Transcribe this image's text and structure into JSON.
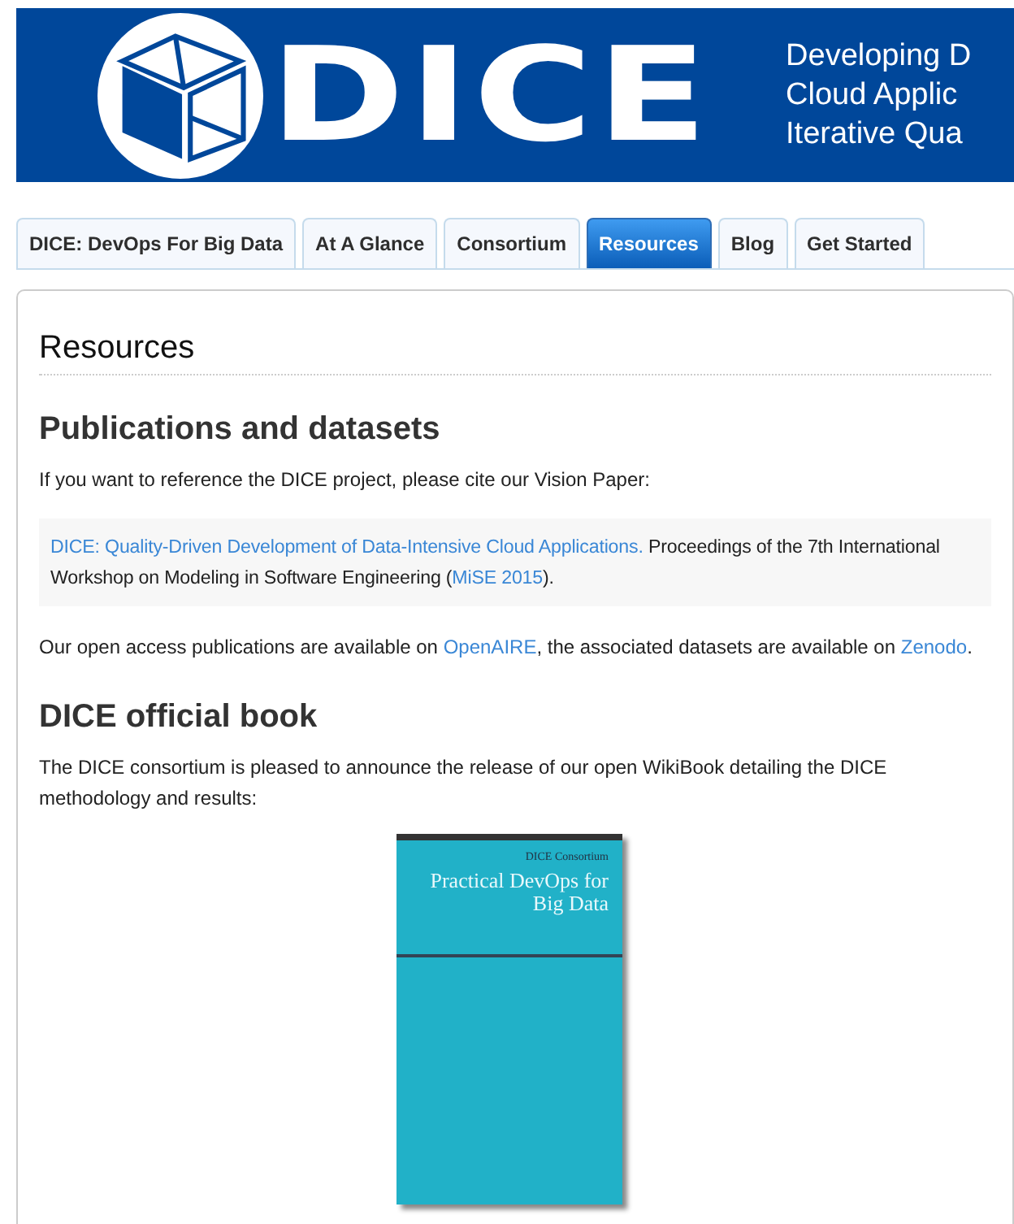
{
  "banner": {
    "logo_text": "DICE",
    "tagline": [
      "Developing D",
      "Cloud Applic",
      "Iterative Qua"
    ]
  },
  "tabs": [
    {
      "label": "DICE: DevOps For Big Data",
      "selected": false
    },
    {
      "label": "At A Glance",
      "selected": false
    },
    {
      "label": "Consortium",
      "selected": false
    },
    {
      "label": "Resources",
      "selected": true
    },
    {
      "label": "Blog",
      "selected": false
    },
    {
      "label": "Get Started",
      "selected": false
    }
  ],
  "page_title": "Resources",
  "sections": [
    {
      "heading": "Publications and datasets",
      "blocks": [
        {
          "kind": "paragraph",
          "segments": [
            {
              "text": "If you want to reference the DICE project, please cite our Vision Paper:",
              "link": false
            }
          ]
        },
        {
          "kind": "citation",
          "segments": [
            {
              "text": "DICE: Quality-Driven Development of Data-Intensive Cloud Applications.",
              "link": true
            },
            {
              "text": " Proceedings of the 7th International Workshop on Modeling in Software Engineering (",
              "link": false
            },
            {
              "text": "MiSE 2015",
              "link": true
            },
            {
              "text": ").",
              "link": false
            }
          ]
        },
        {
          "kind": "paragraph",
          "segments": [
            {
              "text": "Our open access publications are available on ",
              "link": false
            },
            {
              "text": "OpenAIRE",
              "link": true
            },
            {
              "text": ", the associated datasets are available on ",
              "link": false
            },
            {
              "text": "Zenodo",
              "link": true
            },
            {
              "text": ".",
              "link": false
            }
          ]
        }
      ]
    },
    {
      "heading": "DICE official book",
      "blocks": [
        {
          "kind": "paragraph",
          "segments": [
            {
              "text": "The DICE consortium is pleased to announce the release of our open WikiBook detailing the DICE methodology and results:",
              "link": false
            }
          ]
        },
        {
          "kind": "book",
          "author": "DICE Consortium",
          "title": "Practical DevOps for Big Data"
        }
      ]
    }
  ]
}
